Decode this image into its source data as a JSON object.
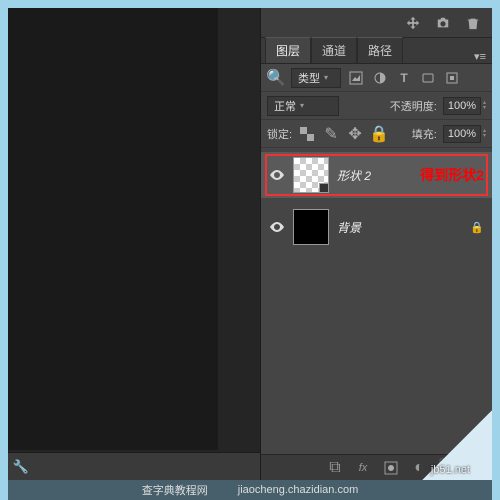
{
  "tabs": {
    "layers": "图层",
    "channels": "通道",
    "paths": "路径"
  },
  "kind_label": "类型",
  "blend": {
    "mode": "正常",
    "opacity_label": "不透明度:",
    "opacity": "100%"
  },
  "lock": {
    "label": "锁定:",
    "fill_label": "填充:",
    "fill": "100%"
  },
  "layers_list": [
    {
      "name": "形状 2"
    },
    {
      "name": "背景"
    }
  ],
  "annotation": "得到形状2",
  "watermark": {
    "site": "查字典教程网",
    "url": "jb51.net",
    "sub": "jiaocheng.chazidian.com"
  },
  "icons": {
    "wrench": "wrench-icon",
    "arrows": "arrows-icon",
    "camera": "camera-icon",
    "trash": "trash-icon",
    "image": "image-icon",
    "circle": "adjustment-icon",
    "text": "text-icon",
    "rect": "shape-icon",
    "fx": "effects-icon",
    "lock": "lock-icon",
    "brush": "brush-icon",
    "move": "move-icon",
    "padlock": "padlock-icon",
    "link": "link-icon",
    "mask": "mask-icon",
    "folder": "folder-icon",
    "new": "new-layer-icon"
  }
}
